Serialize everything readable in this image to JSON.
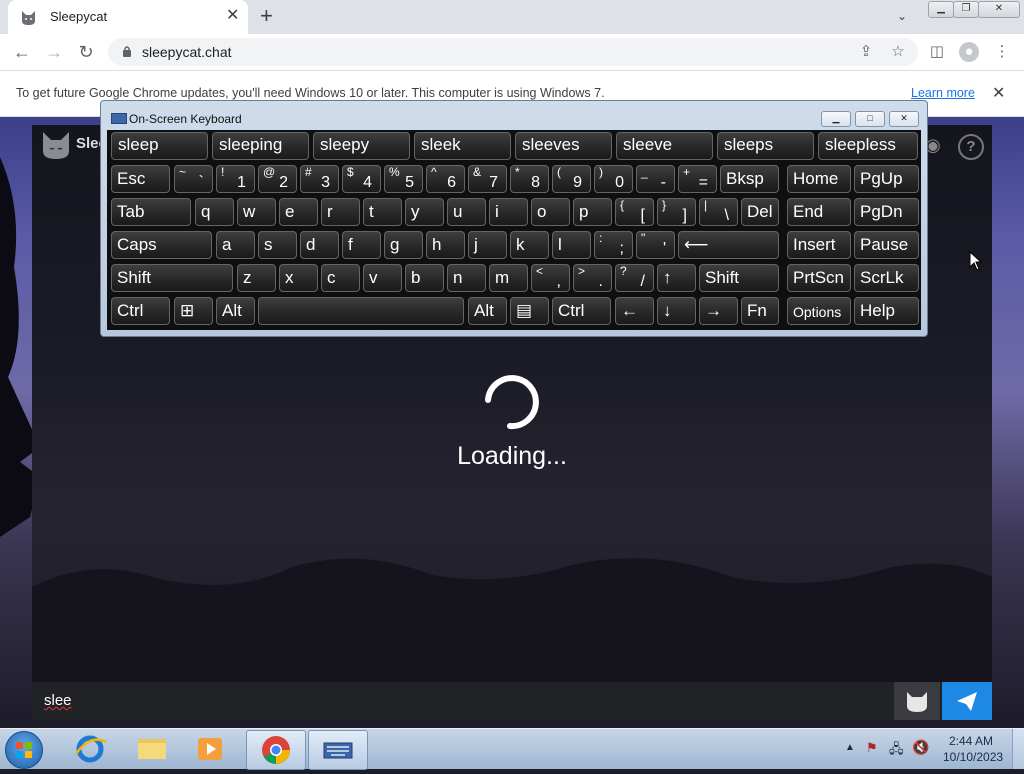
{
  "browser": {
    "tab_title": "Sleepycat",
    "new_tab": "+",
    "tab_menu": "⌄",
    "url": "sleepycat.chat",
    "win_min": "▁",
    "win_restore": "❐",
    "win_close": "✕"
  },
  "infobar": {
    "message": "To get future Google Chrome updates, you'll need Windows 10 or later. This computer is using Windows 7.",
    "link": "Learn more",
    "close": "✕"
  },
  "app": {
    "title": "Slee",
    "help": "?",
    "loading": "Loading...",
    "input_value": "slee"
  },
  "osk": {
    "title": "On-Screen Keyboard",
    "predictions": [
      "sleep",
      "sleeping",
      "sleepy",
      "sleek",
      "sleeves",
      "sleeve",
      "sleeps",
      "sleepless"
    ],
    "keys": {
      "esc": "Esc",
      "tab": "Tab",
      "caps": "Caps",
      "shift": "Shift",
      "shift_r": "Shift",
      "ctrl": "Ctrl",
      "ctrl_r": "Ctrl",
      "alt": "Alt",
      "alt_r": "Alt",
      "fn": "Fn",
      "bksp": "Bksp",
      "del": "Del",
      "enter": "⟵",
      "home": "Home",
      "pgup": "PgUp",
      "end": "End",
      "pgdn": "PgDn",
      "insert": "Insert",
      "pause": "Pause",
      "prtscn": "PrtScn",
      "scrlk": "ScrLk",
      "options": "Options",
      "help": "Help",
      "win": "⊞",
      "menu": "▤",
      "left": "←",
      "down": "↓",
      "right": "→",
      "up": "↑",
      "row_num": [
        [
          "~",
          "`"
        ],
        [
          "!",
          "1"
        ],
        [
          "@",
          "2"
        ],
        [
          "#",
          "3"
        ],
        [
          "$",
          "4"
        ],
        [
          "%",
          "5"
        ],
        [
          "^",
          "6"
        ],
        [
          "&",
          "7"
        ],
        [
          "*",
          "8"
        ],
        [
          "(",
          "9"
        ],
        [
          ")",
          "0"
        ],
        [
          "_",
          "-"
        ],
        [
          "+",
          "="
        ]
      ],
      "row_q": [
        "q",
        "w",
        "e",
        "r",
        "t",
        "y",
        "u",
        "i",
        "o",
        "p"
      ],
      "row_q_sym": [
        [
          "{",
          "["
        ],
        [
          "}",
          "]"
        ],
        [
          "|",
          "\\"
        ]
      ],
      "row_a": [
        "a",
        "s",
        "d",
        "f",
        "g",
        "h",
        "j",
        "k",
        "l"
      ],
      "row_a_sym": [
        [
          ":",
          ";"
        ],
        [
          "\"",
          "'"
        ]
      ],
      "row_z": [
        "z",
        "x",
        "c",
        "v",
        "b",
        "n",
        "m"
      ],
      "row_z_sym": [
        [
          "<",
          ","
        ],
        [
          ">",
          "."
        ],
        [
          "?",
          "/"
        ]
      ]
    }
  },
  "taskbar": {
    "time": "2:44 AM",
    "date": "10/10/2023",
    "tray_arrow": "▲"
  }
}
